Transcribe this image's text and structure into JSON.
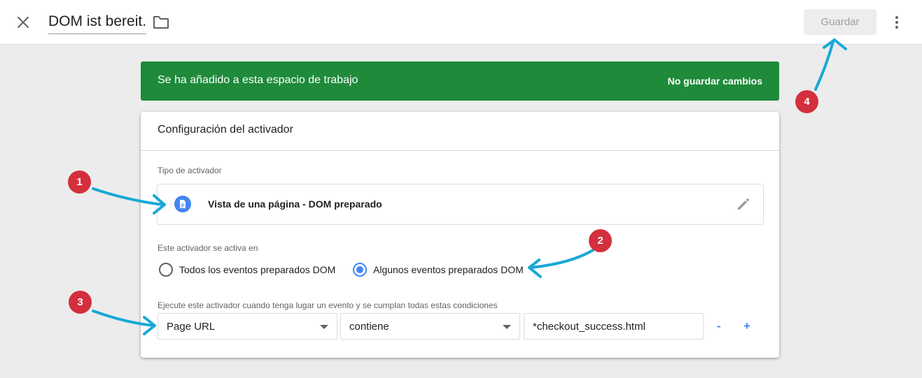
{
  "header": {
    "close_icon": "close-icon",
    "title": "DOM ist bereit.",
    "folder_icon": "folder-icon",
    "save_label": "Guardar",
    "more_icon": "more-vert-icon"
  },
  "banner": {
    "text": "Se ha añadido a esta espacio de trabajo",
    "discard_label": "No guardar cambios",
    "color": "#1e8a3a"
  },
  "card": {
    "title": "Configuración del activador",
    "trigger_type_label": "Tipo de activador",
    "trigger_type_name": "Vista de una página - DOM preparado",
    "trigger_type_icon": "document-icon",
    "edit_icon": "pencil-icon",
    "fires_on_label": "Este activador se activa en",
    "radio_options": [
      {
        "label": "Todos los eventos preparados DOM",
        "checked": false
      },
      {
        "label": "Algunos eventos preparados DOM",
        "checked": true
      }
    ],
    "conditions_label": "Ejecute este activador cuando tenga lugar un evento y se cumplan todas estas condiciones",
    "condition": {
      "variable": "Page URL",
      "operator": "contiene",
      "value": "*checkout_success.html"
    },
    "remove_label": "-",
    "add_label": "+"
  },
  "annotations": {
    "markers": [
      "1",
      "2",
      "3",
      "4"
    ],
    "marker_color": "#d32f3c",
    "arrow_color": "#19a8d6"
  }
}
